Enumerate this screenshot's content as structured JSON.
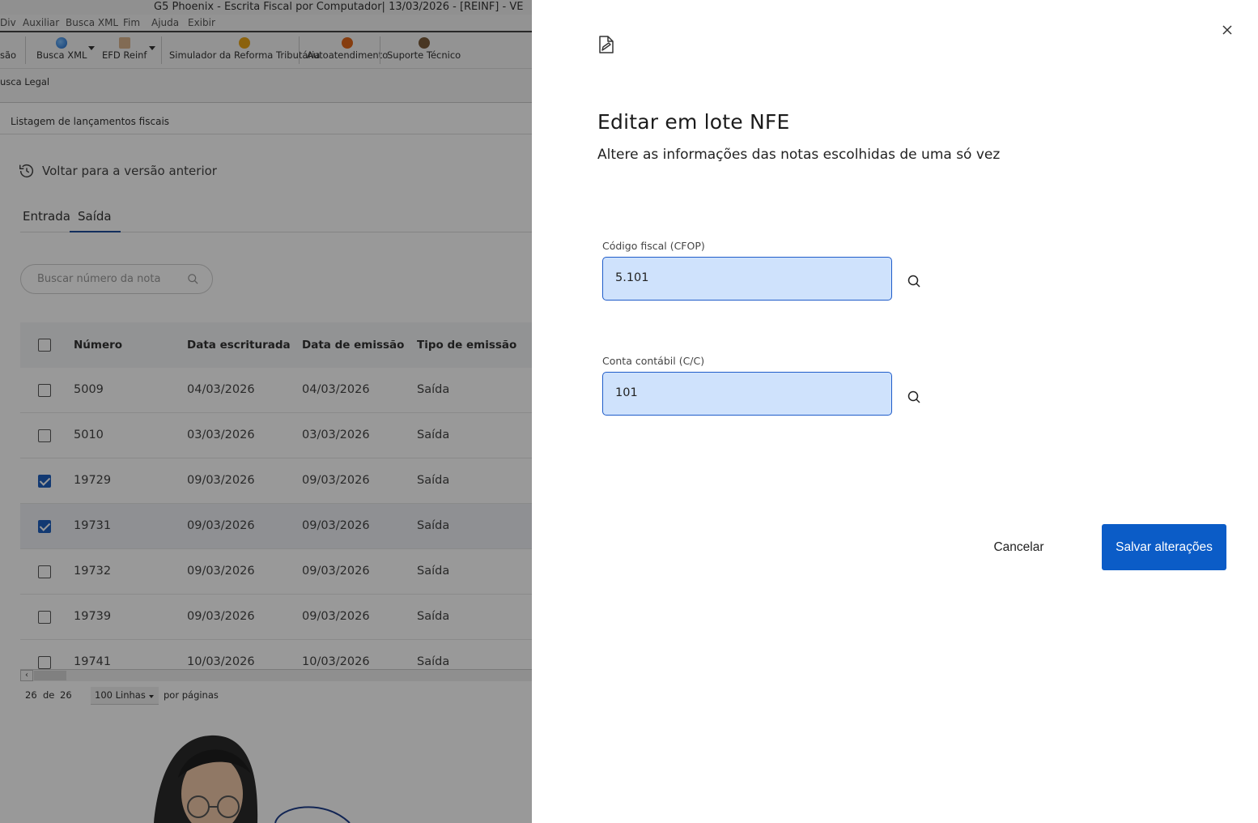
{
  "window": {
    "title": "G5 Phoenix - Escrita Fiscal por Computador|  13/03/2026 - [REINF] - VE"
  },
  "menubar": {
    "items": [
      "Div",
      "Auxiliar",
      "Busca XML",
      "Fim",
      "Ajuda",
      "Exibir"
    ]
  },
  "toolbar": {
    "items": [
      "são",
      "Busca XML",
      "EFD Reinf",
      "Simulador da Reforma Tributária",
      "Autoatendimento",
      "Suporte Técnico"
    ]
  },
  "ribbon2": {
    "label": "usca Legal"
  },
  "page": {
    "label": "Listagem de lançamentos fiscais"
  },
  "back_link": {
    "label": "Voltar para a versão anterior"
  },
  "tabs": [
    {
      "label": "Entrada",
      "active": false
    },
    {
      "label": "Saída",
      "active": true
    }
  ],
  "search": {
    "placeholder": "Buscar número da nota"
  },
  "table": {
    "headers": [
      "Número",
      "Data escriturada",
      "Data de emissão",
      "Tipo de emissão"
    ],
    "rows": [
      {
        "checked": false,
        "numero": "5009",
        "data_escriturada": "04/03/2026",
        "data_emissao": "04/03/2026",
        "tipo": "Saída"
      },
      {
        "checked": false,
        "numero": "5010",
        "data_escriturada": "03/03/2026",
        "data_emissao": "03/03/2026",
        "tipo": "Saída"
      },
      {
        "checked": true,
        "numero": "19729",
        "data_escriturada": "09/03/2026",
        "data_emissao": "09/03/2026",
        "tipo": "Saída"
      },
      {
        "checked": true,
        "numero": "19731",
        "data_escriturada": "09/03/2026",
        "data_emissao": "09/03/2026",
        "tipo": "Saída"
      },
      {
        "checked": false,
        "numero": "19732",
        "data_escriturada": "09/03/2026",
        "data_emissao": "09/03/2026",
        "tipo": "Saída"
      },
      {
        "checked": false,
        "numero": "19739",
        "data_escriturada": "09/03/2026",
        "data_emissao": "09/03/2026",
        "tipo": "Saída"
      },
      {
        "checked": false,
        "numero": "19741",
        "data_escriturada": "10/03/2026",
        "data_emissao": "10/03/2026",
        "tipo": "Saída"
      }
    ]
  },
  "pager": {
    "current": "26",
    "of_label": "de",
    "total": "26",
    "rows_option": "100 Linhas",
    "per_page_label": "por páginas"
  },
  "panel": {
    "title": "Editar em lote NFE",
    "subtitle": "Altere as informações das notas escolhidas de uma só vez",
    "fields": [
      {
        "label": "Código fiscal (CFOP)",
        "value": "5.101"
      },
      {
        "label": "Conta contábil (C/C)",
        "value": "101"
      }
    ],
    "cancel_label": "Cancelar",
    "save_label": "Salvar alterações"
  },
  "colors": {
    "primary": "#0b5cc7",
    "field_bg": "#cfe2fc",
    "field_border": "#1f5cc9",
    "overlay": "rgba(0,0,0,0.4)"
  }
}
